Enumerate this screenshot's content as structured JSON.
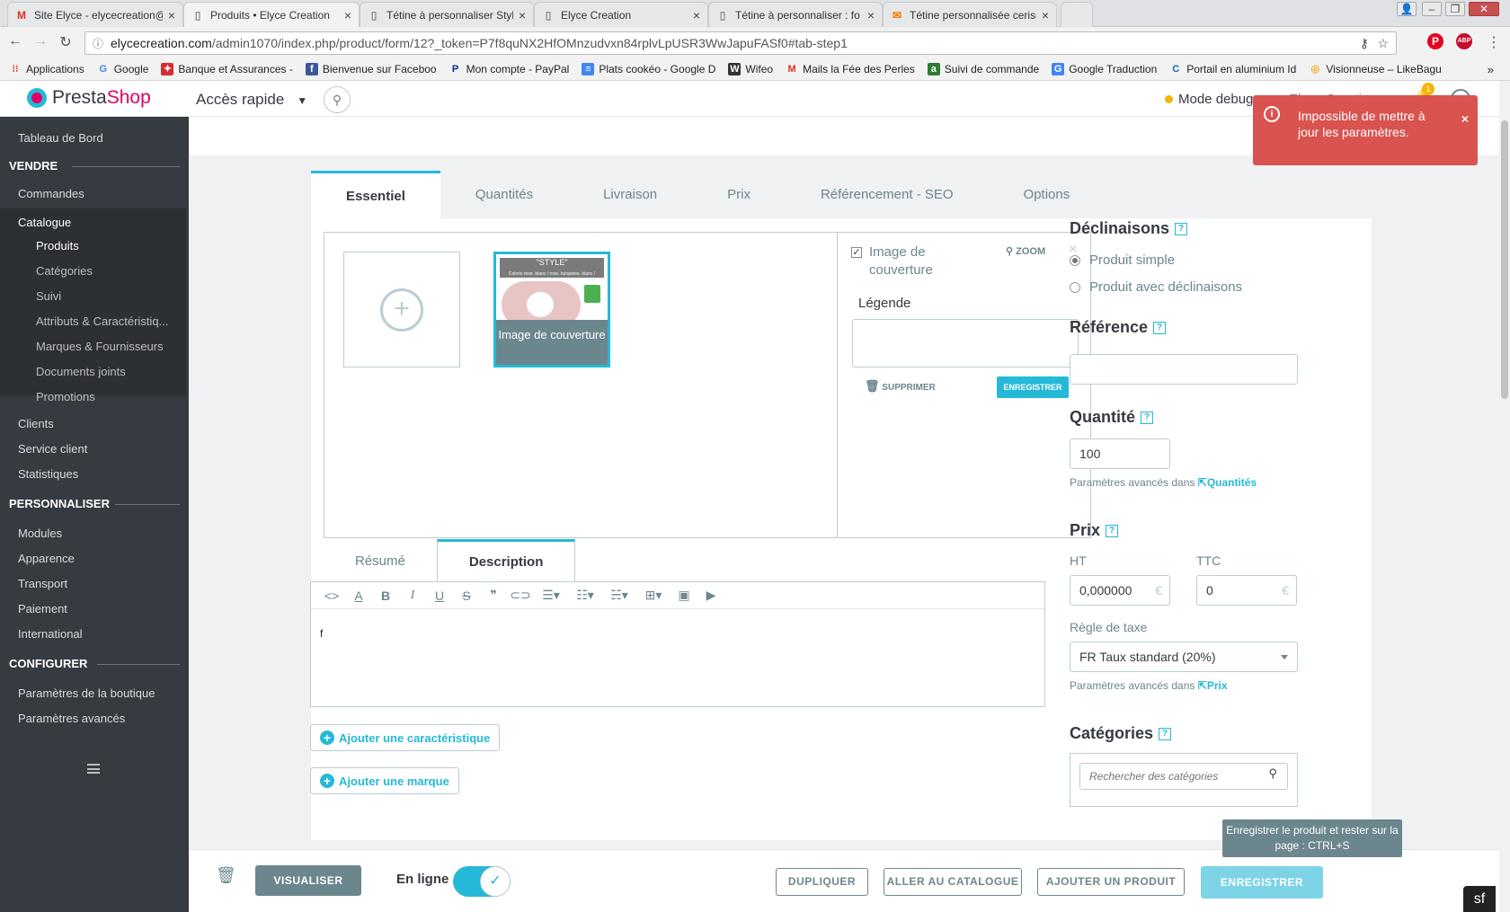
{
  "browser": {
    "tabs": [
      {
        "label": "Site Elyce - elycecreation@",
        "icon": "gmail-icon"
      },
      {
        "label": "Produits • Elyce Creation",
        "icon": "page-icon",
        "active": true
      },
      {
        "label": "Tétine à personnaliser Styl",
        "icon": "page-icon"
      },
      {
        "label": "Elyce Creation",
        "icon": "page-icon"
      },
      {
        "label": "Tétine à personnaliser : fo",
        "icon": "page-icon"
      },
      {
        "label": "Tétine personnalisée cerise",
        "icon": "page-icon"
      }
    ],
    "url_host": "elycecreation.com",
    "url_path": "/admin1070/index.php/product/form/12?_token=P7f8quNX2HfOMnzudvxn84rplvLpUSR3WwJapuFASf0#tab-step1",
    "bookmarks": [
      {
        "label": "Applications",
        "icon": "apps-icon",
        "color": "#e53935"
      },
      {
        "label": "Google",
        "icon": "google-icon",
        "color": "#4285f4"
      },
      {
        "label": "Banque et Assurances -",
        "icon": "bank-icon",
        "color": "#d32f2f"
      },
      {
        "label": "Bienvenue sur Faceboo",
        "icon": "facebook-icon",
        "color": "#3b5998"
      },
      {
        "label": "Mon compte - PayPal",
        "icon": "paypal-icon",
        "color": "#003087"
      },
      {
        "label": "Plats cookéo - Google D",
        "icon": "docs-icon",
        "color": "#4285f4"
      },
      {
        "label": "Wifeo",
        "icon": "wifeo-icon",
        "color": "#333333"
      },
      {
        "label": "Mails la Fée des Perles",
        "icon": "gmail-icon",
        "color": "#d93025"
      },
      {
        "label": "Suivi de commande",
        "icon": "tracking-icon",
        "color": "#2e7d32"
      },
      {
        "label": "Google Traduction",
        "icon": "translate-icon",
        "color": "#4285f4"
      },
      {
        "label": "Portail en aluminium Id",
        "icon": "portal-icon",
        "color": "#1565c0"
      },
      {
        "label": "Visionneuse – LikeBagu",
        "icon": "ring-icon",
        "color": "#f9a825"
      }
    ]
  },
  "header": {
    "logo_a": "Presta",
    "logo_b": "Shop",
    "quick_access": "Accès rapide",
    "debug": "Mode debug",
    "shop": "Elyce Creation",
    "notif_count": "1"
  },
  "sidebar": {
    "dashboard": "Tableau de Bord",
    "sell": "VENDRE",
    "orders": "Commandes",
    "catalog": "Catalogue",
    "catalog_items": [
      "Produits",
      "Catégories",
      "Suivi",
      "Attributs & Caractéristiq...",
      "Marques & Fournisseurs",
      "Documents joints",
      "Promotions"
    ],
    "clients": "Clients",
    "service": "Service client",
    "stats": "Statistiques",
    "customize": "PERSONNALISER",
    "customize_items": [
      "Modules",
      "Apparence",
      "Transport",
      "Paiement",
      "International"
    ],
    "configure": "CONFIGURER",
    "configure_items": [
      "Paramètres de la boutique",
      "Paramètres avancés"
    ]
  },
  "tabs": [
    "Essentiel",
    "Quantités",
    "Livraison",
    "Prix",
    "Référencement - SEO",
    "Options"
  ],
  "images": {
    "thumb_banner": "\"STYLE\"",
    "thumb_banner_small": "Coloris rose, blanc / rose, turquoise, blanc / turquoise",
    "thumb_caption": "Image de couverture",
    "cover_label": "Image de couverture",
    "zoom": "ZOOM",
    "legend_label": "Légende",
    "legend_value": "",
    "delete": "SUPPRIMER",
    "save": "ENREGISTRER"
  },
  "desc_tabs": [
    "Résumé",
    "Description"
  ],
  "editor_text": "f",
  "add_feature": "Ajouter une caractéristique",
  "add_brand": "Ajouter une marque",
  "right": {
    "declinaisons": "Déclinaisons",
    "simple": "Produit simple",
    "with_comb": "Produit avec déclinaisons",
    "reference": "Référence",
    "reference_value": "",
    "quantity": "Quantité",
    "quantity_value": "100",
    "adv_in": "Paramètres avancés dans",
    "adv_qty_link": "Quantités",
    "price": "Prix",
    "ht": "HT",
    "ttc": "TTC",
    "ht_value": "0,000000",
    "ttc_value": "0",
    "currency": "€",
    "tax_rule": "Règle de taxe",
    "tax_value": "FR Taux standard (20%)",
    "adv_price_link": "Prix",
    "categories": "Catégories",
    "cat_search_placeholder": "Rechercher des catégories"
  },
  "alert": {
    "message": "Impossible de mettre à jour les paramètres.",
    "close": "×",
    "color": "#d9534f"
  },
  "tooltip": "Enregistrer le produit et rester sur la page : CTRL+S",
  "footer": {
    "preview": "VISUALISER",
    "online": "En ligne",
    "duplicate": "DUPLIQUER",
    "catalog": "ALLER AU CATALOGUE",
    "add_product": "AJOUTER UN PRODUIT",
    "save": "ENREGISTRER"
  },
  "colors": {
    "accent": "#25b9d7",
    "sidebar": "#363a41",
    "brand": "#df0067"
  }
}
